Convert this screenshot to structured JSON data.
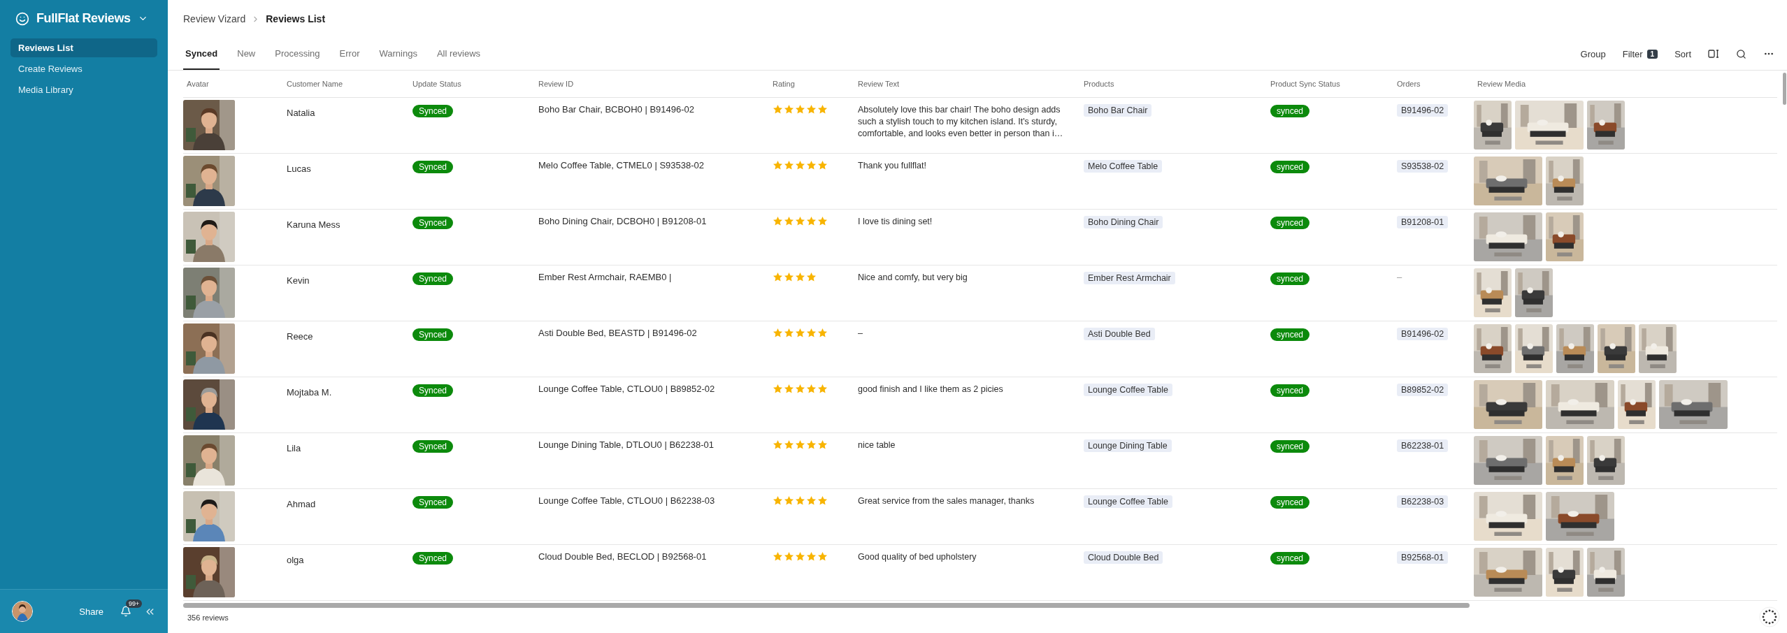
{
  "sidebar": {
    "app_name": "FullFlat Reviews",
    "items": [
      {
        "label": "Reviews List",
        "selected": true
      },
      {
        "label": "Create Reviews",
        "selected": false
      },
      {
        "label": "Media Library",
        "selected": false
      }
    ],
    "share": "Share",
    "notifications_badge": "99+"
  },
  "breadcrumb": [
    "Review Vizard",
    "Reviews List"
  ],
  "tabs": [
    {
      "label": "Synced",
      "selected": true
    },
    {
      "label": "New",
      "selected": false
    },
    {
      "label": "Processing",
      "selected": false
    },
    {
      "label": "Error",
      "selected": false
    },
    {
      "label": "Warnings",
      "selected": false
    },
    {
      "label": "All reviews",
      "selected": false
    }
  ],
  "toolbar": {
    "group": "Group",
    "filter": "Filter",
    "filter_count": "1",
    "sort": "Sort"
  },
  "table": {
    "columns": [
      "Avatar",
      "Customer Name",
      "Update Status",
      "Review ID",
      "Rating",
      "Review Text",
      "Products",
      "Product Sync Status",
      "Orders",
      "Review Media"
    ],
    "rows": [
      {
        "customer": "Natalia",
        "update_status": "Synced",
        "review_id": "Boho Bar Chair, BCBOH0 | B91496-02",
        "stars": 5,
        "review_text": "Absolutely love this bar chair! The boho design adds such a stylish touch to my kitchen island. It's sturdy, comfortable, and looks even better in person than i…",
        "product": "Boho Bar Chair",
        "product_sync_status": "synced",
        "order": "B91496-02",
        "media": [
          {
            "wide": false
          },
          {
            "wide": true
          },
          {
            "wide": false
          }
        ]
      },
      {
        "customer": "Lucas",
        "update_status": "Synced",
        "review_id": "Melo Coffee Table, CTMEL0 | S93538-02",
        "stars": 5,
        "review_text": "Thank you fullflat!",
        "product": "Melo Coffee Table",
        "product_sync_status": "synced",
        "order": "S93538-02",
        "media": [
          {
            "wide": true
          },
          {
            "wide": false
          }
        ]
      },
      {
        "customer": "Karuna Mess",
        "update_status": "Synced",
        "review_id": "Boho Dining Chair, DCBOH0 | B91208-01",
        "stars": 5,
        "review_text": "I love tis dining set!",
        "product": "Boho Dining Chair",
        "product_sync_status": "synced",
        "order": "B91208-01",
        "media": [
          {
            "wide": true
          },
          {
            "wide": false
          }
        ]
      },
      {
        "customer": "Kevin",
        "update_status": "Synced",
        "review_id": "Ember Rest Armchair, RAEMB0 |",
        "stars": 4,
        "review_text": "Nice and comfy, but very big",
        "product": "Ember Rest Armchair",
        "product_sync_status": "synced",
        "order": "–",
        "media": [
          {
            "wide": false
          },
          {
            "wide": false
          }
        ]
      },
      {
        "customer": "Reece",
        "update_status": "Synced",
        "review_id": "Asti Double Bed, BEASTD | B91496-02",
        "stars": 5,
        "review_text": "–",
        "product": "Asti Double Bed",
        "product_sync_status": "synced",
        "order": "B91496-02",
        "media": [
          {
            "wide": false
          },
          {
            "wide": false
          },
          {
            "wide": false
          },
          {
            "wide": false
          },
          {
            "wide": false
          }
        ]
      },
      {
        "customer": "Mojtaba M.",
        "update_status": "Synced",
        "review_id": "Lounge Coffee Table, CTLOU0 | B89852-02",
        "stars": 5,
        "review_text": "good finish and I like them as 2 picies",
        "product": "Lounge Coffee Table",
        "product_sync_status": "synced",
        "order": "B89852-02",
        "media": [
          {
            "wide": true
          },
          {
            "wide": true
          },
          {
            "wide": false
          },
          {
            "wide": true
          }
        ]
      },
      {
        "customer": "Lila",
        "update_status": "Synced",
        "review_id": "Lounge Dining Table, DTLOU0 | B62238-01",
        "stars": 5,
        "review_text": "nice table",
        "product": "Lounge Dining Table",
        "product_sync_status": "synced",
        "order": "B62238-01",
        "media": [
          {
            "wide": true
          },
          {
            "wide": false
          },
          {
            "wide": false
          }
        ]
      },
      {
        "customer": "Ahmad",
        "update_status": "Synced",
        "review_id": "Lounge Coffee Table, CTLOU0 | B62238-03",
        "stars": 5,
        "review_text": "Great service from the sales manager, thanks",
        "product": "Lounge Coffee Table",
        "product_sync_status": "synced",
        "order": "B62238-03",
        "media": [
          {
            "wide": true
          },
          {
            "wide": true
          }
        ]
      },
      {
        "customer": "olga",
        "update_status": "Synced",
        "review_id": "Cloud Double Bed, BECLOD | B92568-01",
        "stars": 5,
        "review_text": "Good quality of bed upholstery",
        "product": "Cloud Double Bed",
        "product_sync_status": "synced",
        "order": "B92568-01",
        "media": [
          {
            "wide": true
          },
          {
            "wide": false
          },
          {
            "wide": false
          }
        ]
      }
    ]
  },
  "status_bar": {
    "count": "356 reviews"
  }
}
